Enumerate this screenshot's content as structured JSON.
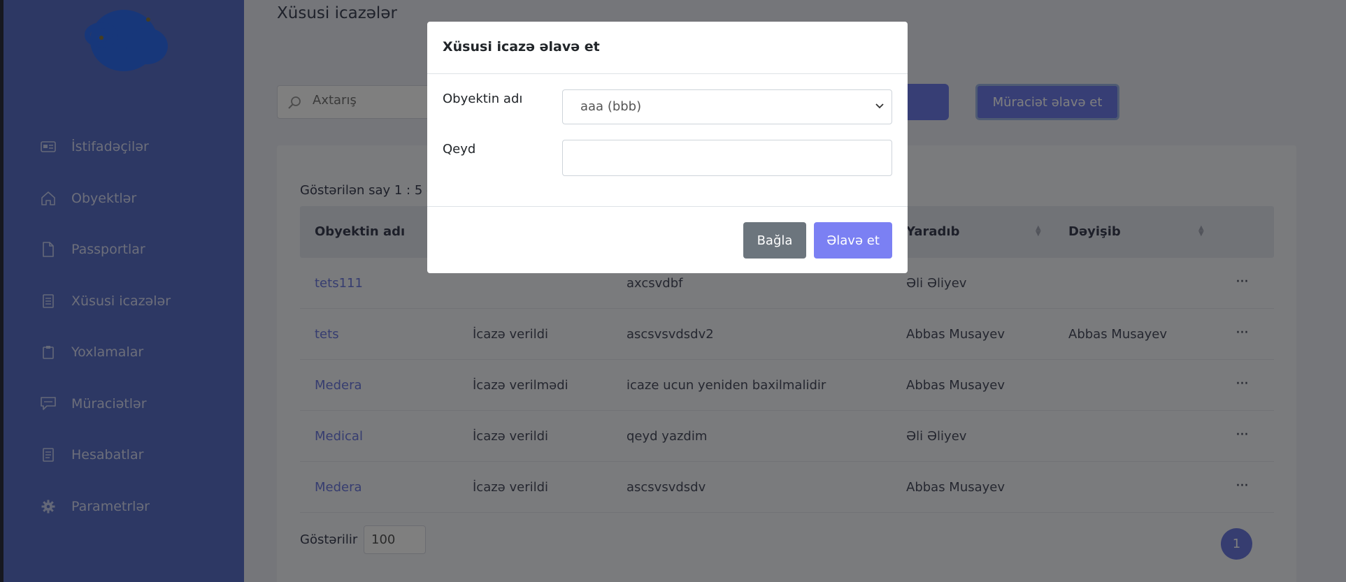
{
  "sidebar": {
    "items": [
      {
        "label": "İstifadəçilər",
        "icon": "id-card-icon"
      },
      {
        "label": "Obyektlər",
        "icon": "home-icon"
      },
      {
        "label": "Passportlar",
        "icon": "file-icon"
      },
      {
        "label": "Xüsusi icazələr",
        "icon": "document-icon"
      },
      {
        "label": "Yoxlamalar",
        "icon": "clipboard-icon"
      },
      {
        "label": "Müraciətlər",
        "icon": "message-icon"
      },
      {
        "label": "Hesabatlar",
        "icon": "report-icon"
      },
      {
        "label": "Parametrlər",
        "icon": "gear-icon"
      }
    ]
  },
  "main": {
    "title": "Xüsusi icazələr",
    "search_placeholder": "Axtarış",
    "apply_button": "Müraciət əlavə et",
    "shown_count": "Göstərilən say 1 : 5 -",
    "table": {
      "columns": [
        "Obyektin adı",
        "",
        "",
        "Yaradıb",
        "Dəyişib"
      ],
      "rows": [
        {
          "name": "tets111",
          "status": "",
          "note": "axcsvdbf",
          "created": "Əli Əliyev",
          "changed": ""
        },
        {
          "name": "tets",
          "status": "İcazə verildi",
          "note": "ascsvsvdsdv2",
          "created": "Abbas Musayev",
          "changed": "Abbas Musayev"
        },
        {
          "name": "Medera",
          "status": "İcazə verilmədi",
          "note": "icaze ucun yeniden baxilmalidir",
          "created": "Abbas Musayev",
          "changed": ""
        },
        {
          "name": "Medical",
          "status": "İcazə verildi",
          "note": "qeyd yazdim",
          "created": "Əli Əliyev",
          "changed": ""
        },
        {
          "name": "Medera",
          "status": "İcazə verildi",
          "note": "ascsvsvdsdv",
          "created": "Abbas Musayev",
          "changed": ""
        }
      ],
      "row_menu": "···"
    },
    "perpage_label": "Göstərilir",
    "perpage_value": "100",
    "page": "1"
  },
  "modal": {
    "title": "Xüsusi icazə əlavə et",
    "object_label": "Obyektin adı",
    "object_value": "aaa (bbb)",
    "note_label": "Qeyd",
    "note_value": "",
    "close_button": "Bağla",
    "add_button": "Əlavə et"
  },
  "colors": {
    "sidebar": "#5a70c9",
    "accent": "#6d7ae0",
    "add_button": "#7b80f3",
    "close_button": "#6c757d"
  }
}
